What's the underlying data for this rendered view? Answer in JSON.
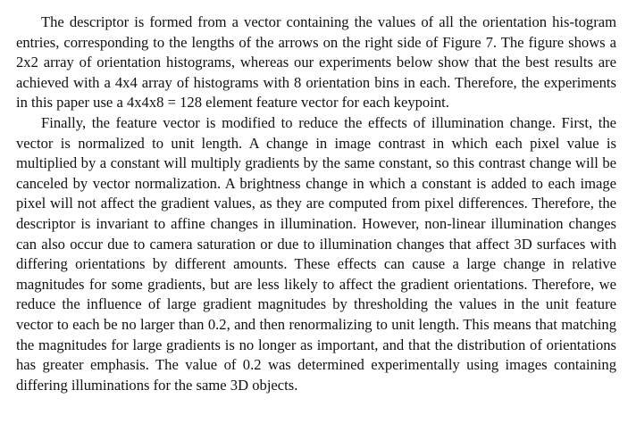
{
  "paragraphs": [
    "The descriptor is formed from a vector containing the values of all the orientation his-togram entries, corresponding to the lengths of the arrows on the right side of Figure 7. The figure shows a 2x2 array of orientation histograms, whereas our experiments below show that the best results are achieved with a 4x4 array of histograms with 8 orientation bins in each. Therefore, the experiments in this paper use a 4x4x8 = 128 element feature vector for each keypoint.",
    "Finally, the feature vector is modified to reduce the effects of illumination change. First, the vector is normalized to unit length. A change in image contrast in which each pixel value is multiplied by a constant will multiply gradients by the same constant, so this contrast change will be canceled by vector normalization. A brightness change in which a constant is added to each image pixel will not affect the gradient values, as they are computed from pixel differences. Therefore, the descriptor is invariant to affine changes in illumination. However, non-linear illumination changes can also occur due to camera saturation or due to illumination changes that affect 3D surfaces with differing orientations by different amounts. These effects can cause a large change in relative magnitudes for some gradients, but are less likely to affect the gradient orientations. Therefore, we reduce the influence of large gradient magnitudes by thresholding the values in the unit feature vector to each be no larger than 0.2, and then renormalizing to unit length. This means that matching the magnitudes for large gradients is no longer as important, and that the distribution of orientations has greater emphasis. The value of 0.2 was determined experimentally using images containing differing illuminations for the same 3D objects."
  ]
}
